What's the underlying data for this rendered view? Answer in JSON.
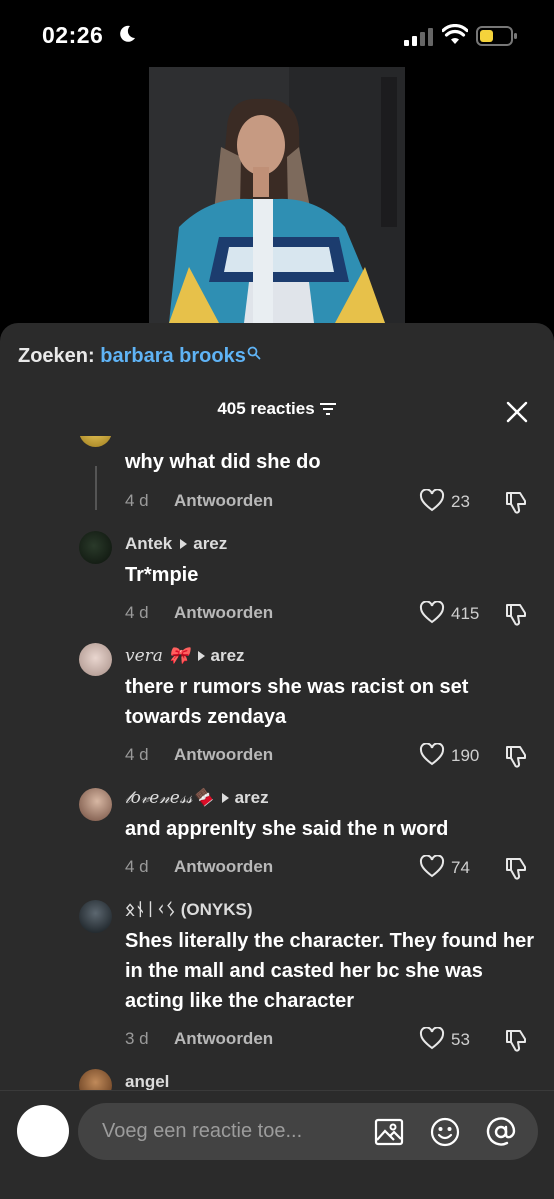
{
  "status_bar": {
    "time": "02:26"
  },
  "video": {
    "description": "video thumbnail"
  },
  "search": {
    "label": "Zoeken:",
    "query": "barbara brooks"
  },
  "header": {
    "count_label": "405 reacties"
  },
  "comments": [
    {
      "username": "",
      "reply_to": "",
      "text": "why what did she do",
      "age": "4 d",
      "reply_label": "Antwoorden",
      "likes": "23"
    },
    {
      "username": "Antek",
      "reply_to": "arez",
      "text": "Tr*mpie",
      "age": "4 d",
      "reply_label": "Antwoorden",
      "likes": "415"
    },
    {
      "username": "vera 🎀",
      "reply_to": "arez",
      "text": "there r rumors she was racist on set towards zendaya",
      "age": "4 d",
      "reply_label": "Antwoorden",
      "likes": "190"
    },
    {
      "username": "𝓁𝑜𝓋𝑒𝓃𝑒𝓈𝓈🍫",
      "reply_to": "arez",
      "text": "and apprenlty she said the n word",
      "age": "4 d",
      "reply_label": "Antwoorden",
      "likes": "74"
    },
    {
      "username": "ᛟᚾᛁᚲᛊ (ONYKS)",
      "reply_to": "",
      "text": "Shes literally the character. They found her in the mall and casted her bc she was acting like the character",
      "age": "3 d",
      "reply_label": "Antwoorden",
      "likes": "53"
    },
    {
      "username": "angel",
      "reply_to": "",
      "text": "",
      "age": "",
      "reply_label": "",
      "likes": ""
    }
  ],
  "composer": {
    "placeholder": "Voeg een reactie toe..."
  },
  "colors": {
    "sheet": "#2b2b2b",
    "search_query": "#5fb3f5",
    "battery": "#f5d33b"
  }
}
